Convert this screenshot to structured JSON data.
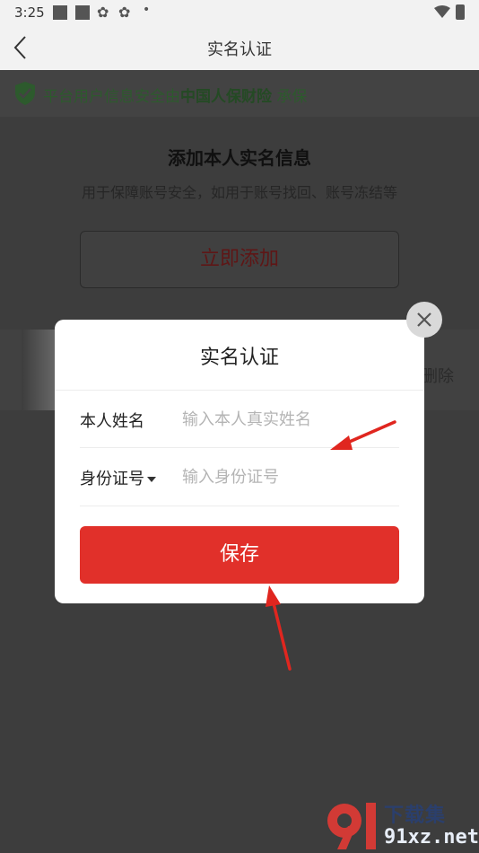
{
  "status_bar": {
    "time": "3:25"
  },
  "nav": {
    "title": "实名认证"
  },
  "banner": {
    "text_prefix": "平台用户信息安全由",
    "brand": "中国人保财险",
    "text_suffix": "承保"
  },
  "add_section": {
    "title": "添加本人实名信息",
    "subtitle": "用于保障账号安全，如用于账号找回、账号冻结等",
    "button": "立即添加"
  },
  "list_item": {
    "delete_label": "删除"
  },
  "modal": {
    "title": "实名认证",
    "name_label": "本人姓名",
    "name_placeholder": "输入本人真实姓名",
    "id_label": "身份证号",
    "id_placeholder": "输入身份证号",
    "save_label": "保存"
  },
  "watermark": {
    "cn": "下载集",
    "url": "91xz.net"
  },
  "colors": {
    "accent": "#e1302a",
    "shield": "#2d5a2d",
    "overlay": "#3e3e3e"
  }
}
